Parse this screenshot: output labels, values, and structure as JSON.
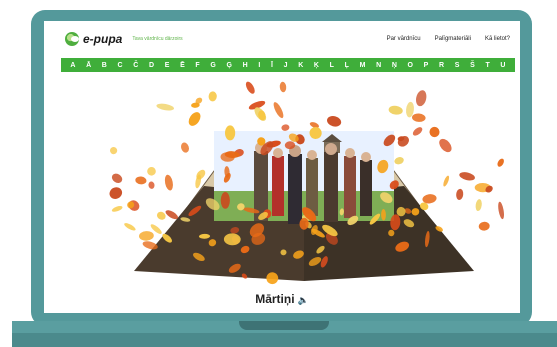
{
  "header": {
    "logo_text": "e-pupa",
    "tagline": "Tava vārdnīcu dārzoirs",
    "nav": [
      "Par vārdnīcu",
      "Palīgmateriāli",
      "Kā lietot?"
    ]
  },
  "alphabet": [
    "A",
    "Ā",
    "B",
    "C",
    "Č",
    "D",
    "E",
    "Ē",
    "F",
    "G",
    "Ģ",
    "H",
    "I",
    "Ī",
    "J",
    "K",
    "Ķ",
    "L",
    "Ļ",
    "M",
    "N",
    "Ņ",
    "O",
    "P",
    "R",
    "S",
    "Š",
    "T",
    "U"
  ],
  "word": {
    "title": "Mārtiņi"
  },
  "icons": {
    "speaker": "speaker-icon",
    "logo": "logo-icon"
  },
  "colors": {
    "accent_green": "#3fae3a",
    "frame_teal": "#54999b"
  }
}
